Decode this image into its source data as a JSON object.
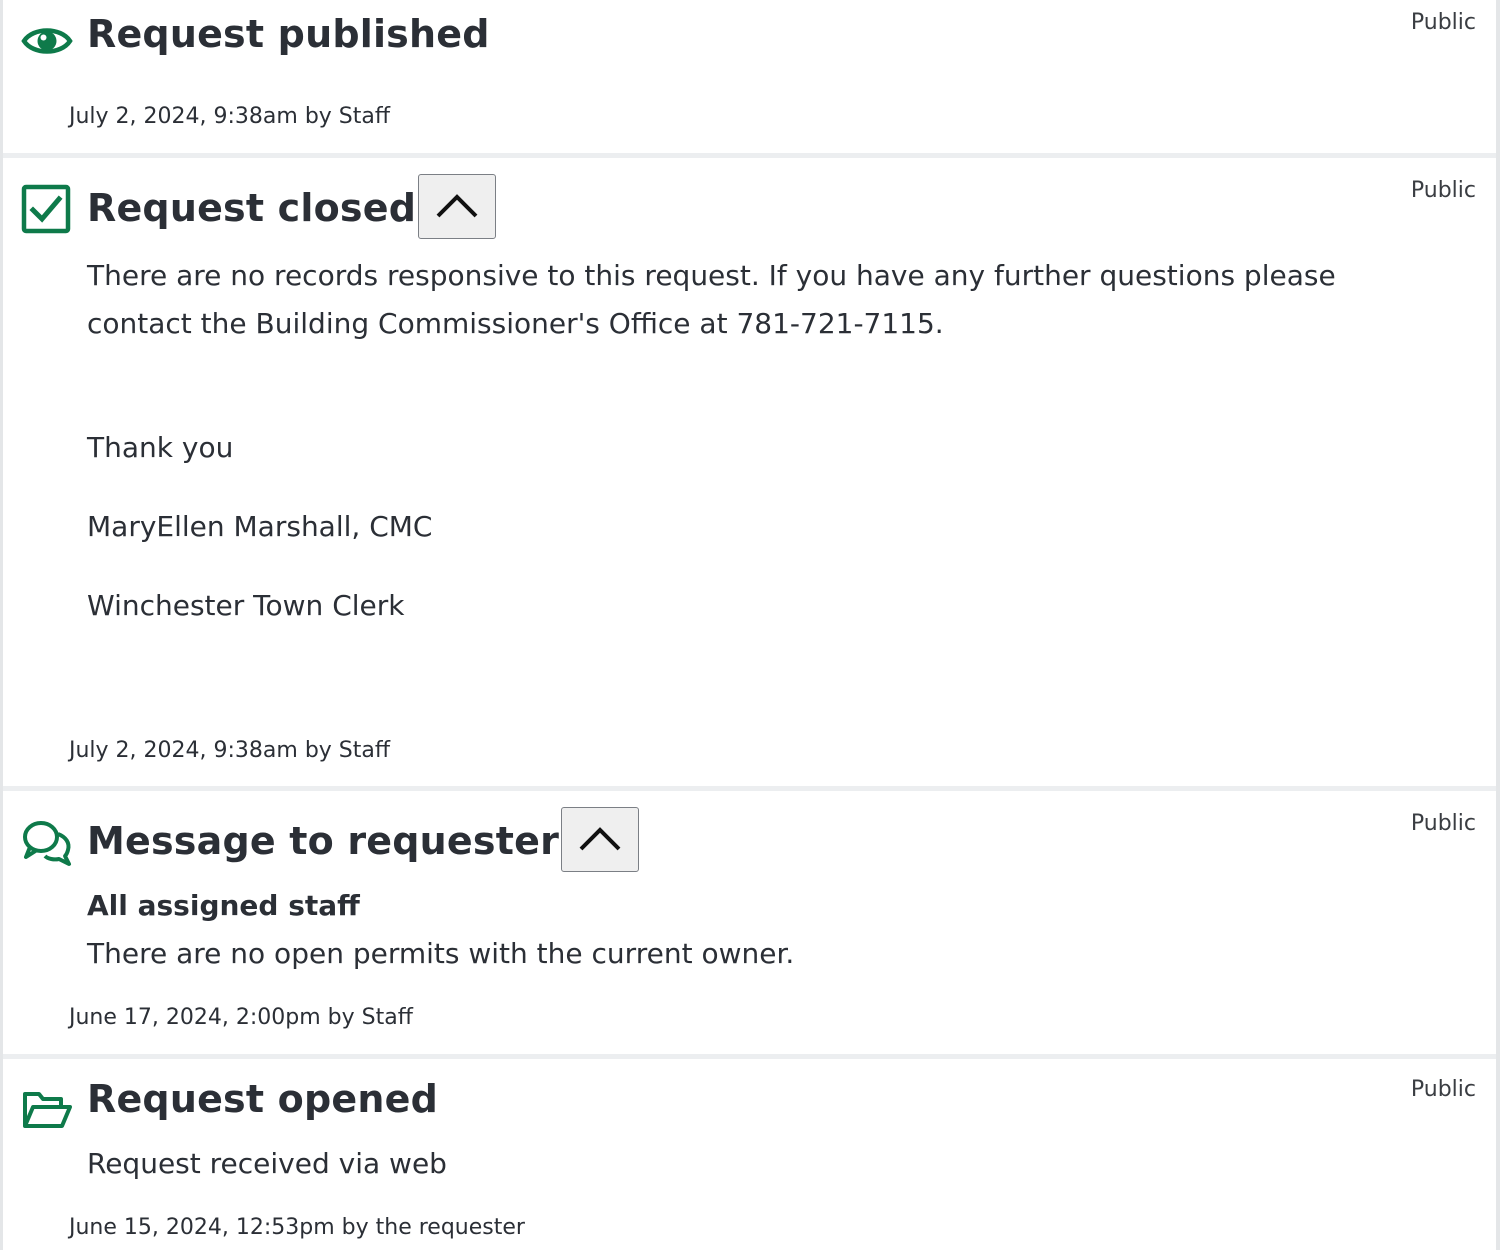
{
  "colors": {
    "accent_green": "#0e7a4a",
    "text": "#2b2f36",
    "separator": "#eceef0"
  },
  "events": [
    {
      "icon": "eye-icon",
      "title": "Request published",
      "visibility": "Public",
      "meta": "July 2, 2024, 9:38am by Staff"
    },
    {
      "icon": "checkbox-checked-icon",
      "title": "Request closed",
      "visibility": "Public",
      "collapse_icon": "chevron-up-icon",
      "body_paragraph": "There are no records responsive to this request. If you have any further questions please contact the Building Commissioner's Office at 781-721-7115.",
      "body_lines": [
        "Thank you",
        "MaryEllen Marshall, CMC",
        "Winchester Town Clerk"
      ],
      "meta": "July 2, 2024, 9:38am by Staff"
    },
    {
      "icon": "chat-bubbles-icon",
      "title": "Message to requester",
      "visibility": "Public",
      "collapse_icon": "chevron-up-icon",
      "recipient": "All assigned staff",
      "body_paragraph": "There are no open permits with the current owner.",
      "meta": "June 17, 2024, 2:00pm by Staff"
    },
    {
      "icon": "folder-open-icon",
      "title": "Request opened",
      "visibility": "Public",
      "body_paragraph": "Request received via web",
      "meta": "June 15, 2024, 12:53pm by the requester"
    }
  ]
}
